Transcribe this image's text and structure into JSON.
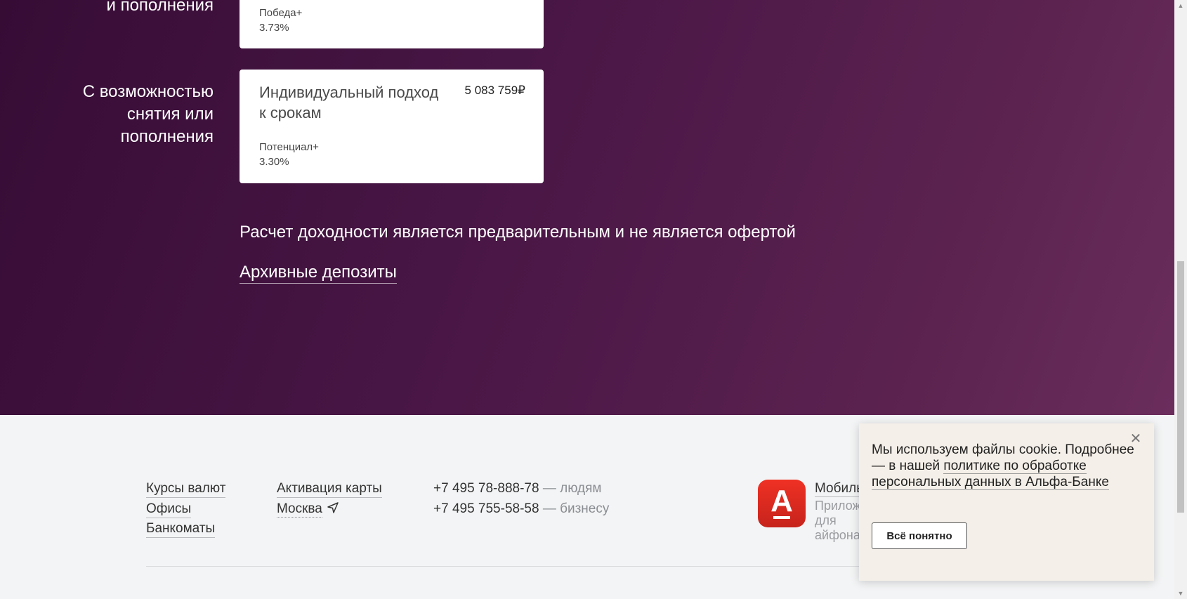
{
  "deposits": {
    "top_category": "и пополнения",
    "top_card": {
      "product": "Победа+",
      "rate": "3.73%"
    },
    "category": "С возможностью снятия или пополнения",
    "card": {
      "title": "Индивидуальный подход к срокам",
      "sum": "5 083 759₽",
      "product": "Потенциал+",
      "rate": "3.30%"
    },
    "note": "Расчет доходности является предварительным и не является офертой",
    "archive_link": "Архивные депозиты"
  },
  "footer": {
    "links_col1": [
      "Курсы валют",
      "Офисы",
      "Банкоматы"
    ],
    "links_col2": [
      "Активация карты",
      "Москва"
    ],
    "phones": [
      {
        "number": "+7 495 78-888-78",
        "who": " — людям"
      },
      {
        "number": "+7 495 755-58-58",
        "who": " — бизнесу"
      }
    ],
    "app": {
      "icon_letter": "А",
      "title": "Мобильный банк",
      "description": "Приложение для айфона"
    }
  },
  "cookie": {
    "text_prefix": "Мы используем файлы cookie. Подробнее — в нашей ",
    "link": "политике по обработке персональных данных в Альфа-Банке",
    "button": "Всё понятно",
    "close": "✕"
  }
}
